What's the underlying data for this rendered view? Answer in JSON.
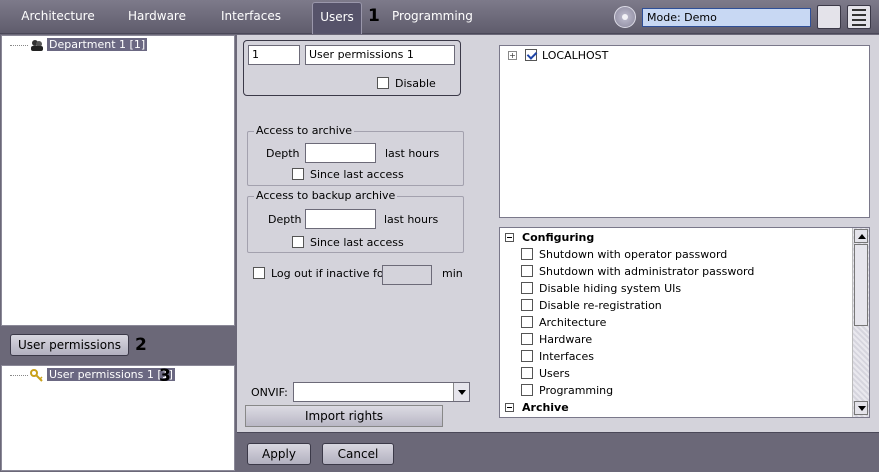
{
  "tabs": [
    {
      "label": "Architecture"
    },
    {
      "label": "Hardware"
    },
    {
      "label": "Interfaces"
    },
    {
      "label": "Users"
    },
    {
      "label": "Programming"
    }
  ],
  "callouts": {
    "one": "1",
    "two": "2",
    "three": "3"
  },
  "mode": {
    "value": "Mode: Demo"
  },
  "left": {
    "department_node": "Department 1 [1]",
    "user_permissions_button": "User permissions",
    "permission_node": "User permissions 1 [1]"
  },
  "form": {
    "id_value": "1",
    "name_value": "User permissions 1",
    "disable_label": "Disable",
    "archive": {
      "title": "Access to archive",
      "depth_label": "Depth",
      "depth_value": "",
      "unit": "last hours",
      "since_label": "Since last access"
    },
    "backup": {
      "title": "Access to backup archive",
      "depth_label": "Depth",
      "depth_value": "",
      "unit": "last hours",
      "since_label": "Since last access"
    },
    "logout_label": "Log out if inactive for",
    "logout_value": "",
    "logout_unit": "min",
    "onvif_label": "ONVIF:",
    "onvif_value": "",
    "import_button": "Import rights"
  },
  "server_tree": {
    "root": "LOCALHOST",
    "root_checked": true
  },
  "permissions": {
    "sections": [
      {
        "title": "Configuring"
      },
      {
        "title": "Archive"
      }
    ],
    "items": [
      {
        "label": "Shutdown with operator password",
        "checked": false
      },
      {
        "label": "Shutdown with administrator password",
        "checked": false
      },
      {
        "label": "Disable hiding system UIs",
        "checked": false
      },
      {
        "label": "Disable re-registration",
        "checked": false
      },
      {
        "label": "Architecture",
        "checked": false
      },
      {
        "label": "Hardware",
        "checked": false
      },
      {
        "label": "Interfaces",
        "checked": false
      },
      {
        "label": "Users",
        "checked": false
      },
      {
        "label": "Programming",
        "checked": false
      }
    ]
  },
  "footer": {
    "apply": "Apply",
    "cancel": "Cancel"
  }
}
